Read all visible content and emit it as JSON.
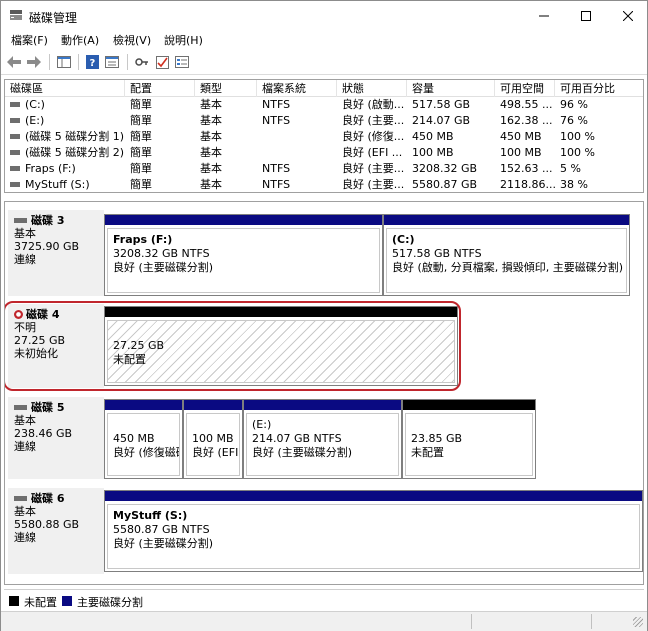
{
  "window": {
    "title": "磁碟管理"
  },
  "menu": {
    "file": "檔案(F)",
    "action": "動作(A)",
    "view": "檢視(V)",
    "help": "說明(H)"
  },
  "columns": {
    "volume": "磁碟區",
    "layout": "配置",
    "type": "類型",
    "fs": "檔案系統",
    "status": "狀態",
    "capacity": "容量",
    "free": "可用空間",
    "free_pct": "可用百分比"
  },
  "volumes": [
    {
      "name": "(C:)",
      "layout": "簡單",
      "type": "基本",
      "fs": "NTFS",
      "status": "良好 (啟動...",
      "capacity": "517.58 GB",
      "free": "498.55 ...",
      "pct": "96 %"
    },
    {
      "name": "(E:)",
      "layout": "簡單",
      "type": "基本",
      "fs": "NTFS",
      "status": "良好 (主要...",
      "capacity": "214.07 GB",
      "free": "162.38 ...",
      "pct": "76 %"
    },
    {
      "name": "(磁碟 5 磁碟分割 1)",
      "layout": "簡單",
      "type": "基本",
      "fs": "",
      "status": "良好 (修復...",
      "capacity": "450 MB",
      "free": "450 MB",
      "pct": "100 %"
    },
    {
      "name": "(磁碟 5 磁碟分割 2)",
      "layout": "簡單",
      "type": "基本",
      "fs": "",
      "status": "良好 (EFI ...",
      "capacity": "100 MB",
      "free": "100 MB",
      "pct": "100 %"
    },
    {
      "name": "Fraps (F:)",
      "layout": "簡單",
      "type": "基本",
      "fs": "NTFS",
      "status": "良好 (主要...",
      "capacity": "3208.32 GB",
      "free": "152.63 ...",
      "pct": "5 %"
    },
    {
      "name": "MyStuff (S:)",
      "layout": "簡單",
      "type": "基本",
      "fs": "NTFS",
      "status": "良好 (主要...",
      "capacity": "5580.87 GB",
      "free": "2118.86...",
      "pct": "38 %"
    }
  ],
  "disks": {
    "d3": {
      "name": "磁碟 3",
      "type": "基本",
      "size": "3725.90 GB",
      "state": "連線",
      "p1": {
        "name": "Fraps  (F:)",
        "size": "3208.32 GB NTFS",
        "status": "良好 (主要磁碟分割)"
      },
      "p2": {
        "name": "(C:)",
        "size": "517.58 GB NTFS",
        "status": "良好 (啟動, 分頁檔案, 損毀傾印, 主要磁碟分割)"
      }
    },
    "d4": {
      "name": "磁碟 4",
      "type": "不明",
      "size": "27.25 GB",
      "state": "未初始化",
      "p1": {
        "size": "27.25 GB",
        "status": "未配置"
      }
    },
    "d5": {
      "name": "磁碟 5",
      "type": "基本",
      "size": "238.46 GB",
      "state": "連線",
      "p1": {
        "size": "450 MB",
        "status": "良好 (修復磁碟"
      },
      "p2": {
        "size": "100 MB",
        "status": "良好 (EFI"
      },
      "p3": {
        "name": "(E:)",
        "size": "214.07 GB NTFS",
        "status": "良好 (主要磁碟分割)"
      },
      "p4": {
        "size": "23.85 GB",
        "status": "未配置"
      }
    },
    "d6": {
      "name": "磁碟 6",
      "type": "基本",
      "size": "5580.88 GB",
      "state": "連線",
      "p1": {
        "name": "MyStuff  (S:)",
        "size": "5580.87 GB NTFS",
        "status": "良好 (主要磁碟分割)"
      }
    }
  },
  "legend": {
    "unallocated": "未配置",
    "primary": "主要磁碟分割"
  },
  "colors": {
    "primary": "#0a0a82",
    "unallocated": "#000000",
    "highlight": "#c0262d"
  }
}
